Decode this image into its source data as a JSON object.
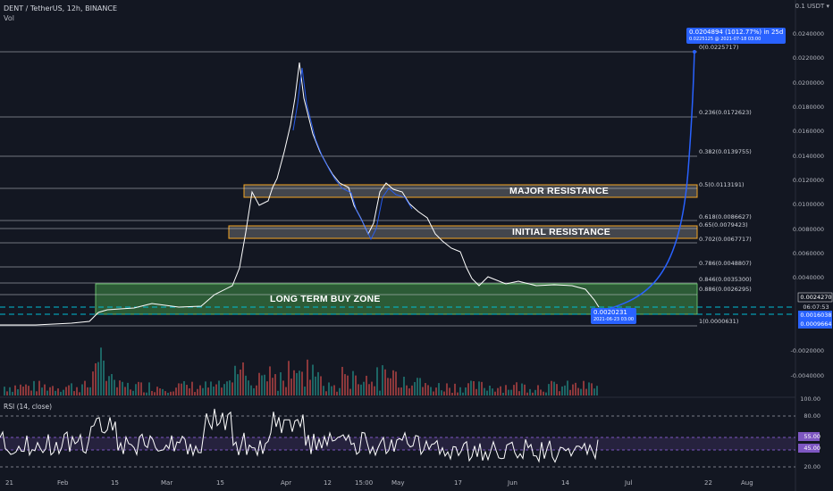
{
  "header": {
    "symbol_line": "DENT / TetherUS, 12h, BINANCE",
    "volume_label": "Vol"
  },
  "price_axis_top": "0.1  USDT  ▾",
  "price_axis": {
    "ticks": [
      "0.0240000",
      "0.0220000",
      "0.0200000",
      "0.0180000",
      "0.0160000",
      "0.0140000",
      "0.0120000",
      "0.0100000",
      "0.0080000",
      "0.0060000",
      "0.0040000",
      "-0.0020000",
      "-0.0040000"
    ],
    "current_price_tag": "0.0024270",
    "countdown_tag": "06:07:53",
    "blue_tag_1": "0.0016038",
    "blue_tag_2": "0.0009664"
  },
  "fib_levels": [
    "0(0.0225717)",
    "0.236(0.0172623)",
    "0.382(0.0139755)",
    "0.5(0.0113191)",
    "0.618(0.0086627)",
    "0.65(0.0079423)",
    "0.702(0.0067717)",
    "0.786(0.0048807)",
    "0.846(0.0035300)",
    "0.886(0.0026295)",
    "1(0.0000631)"
  ],
  "zones": {
    "major": "MAJOR RESISTANCE",
    "initial": "INITIAL RESISTANCE",
    "buy": "LONG TERM BUY ZONE"
  },
  "callouts": {
    "target_main": "0.0204894 (1012.77%) in 25d",
    "target_sub": "0.0225125 @ 2021-07-18  03:00",
    "low_main": "0.0020231",
    "low_sub": "2021-06-23  03:00"
  },
  "rsi": {
    "label": "RSI (14, close)",
    "ticks": [
      "100.00",
      "80.00",
      "55.00",
      "45.00",
      "20.00"
    ]
  },
  "date_axis": [
    "21",
    "Feb",
    "15",
    "Mar",
    "15",
    "Apr",
    "12",
    "15:00",
    "May",
    "17",
    "Jun",
    "14",
    "Jul",
    "22",
    "Aug"
  ],
  "colors": {
    "background": "#131722",
    "buy_zone": "#4caf50",
    "resistance_zone": "#f5a623",
    "price_line": "#2962ff",
    "rsi_line": "#ffffff",
    "rsi_band": "#7e57c2"
  }
}
